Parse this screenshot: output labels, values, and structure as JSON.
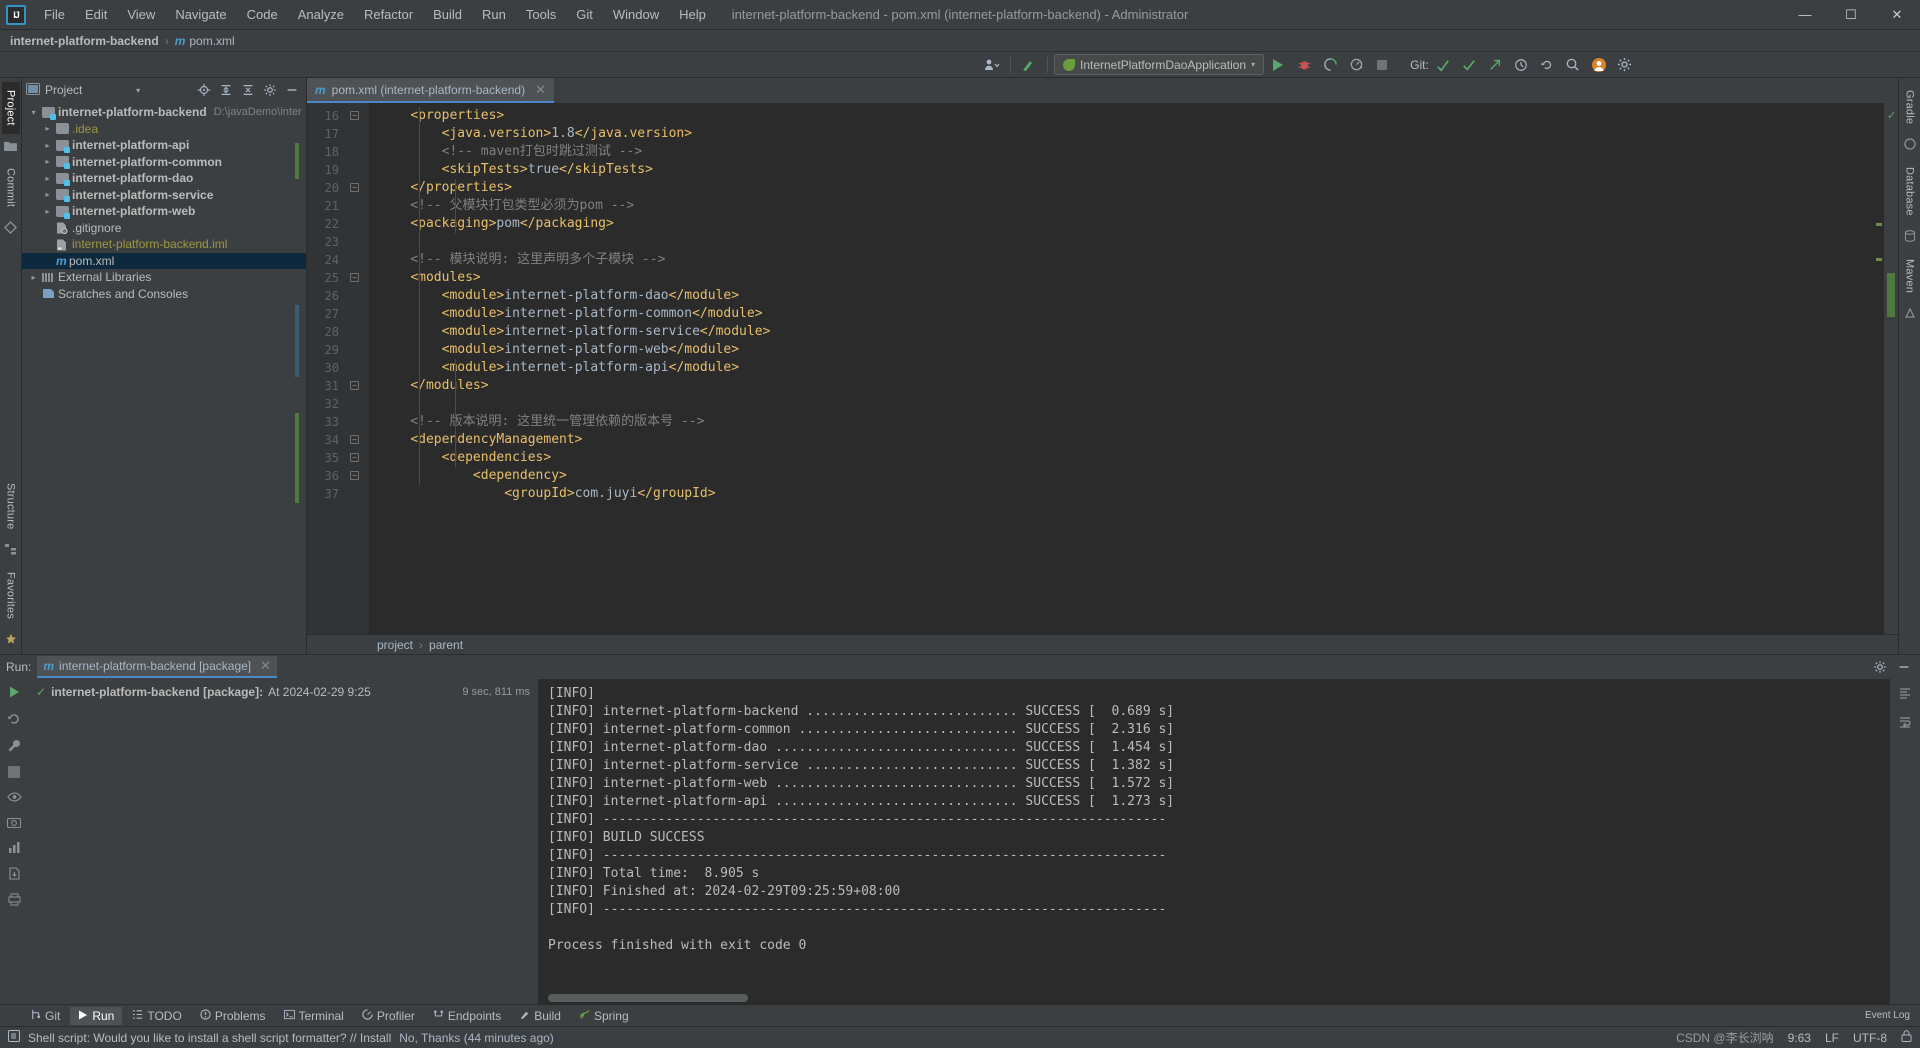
{
  "window": {
    "title": "internet-platform-backend - pom.xml (internet-platform-backend) - Administrator",
    "minimize": "—",
    "maximize": "☐",
    "close": "✕"
  },
  "menu": [
    "File",
    "Edit",
    "View",
    "Navigate",
    "Code",
    "Analyze",
    "Refactor",
    "Build",
    "Run",
    "Tools",
    "Git",
    "Window",
    "Help"
  ],
  "navbar": {
    "project": "internet-platform-backend",
    "separator": "›",
    "file": "pom.xml",
    "file_icon": "m"
  },
  "toolbar": {
    "user_icon": "user-dropdown",
    "vcs_update": "update-project",
    "run_config": "InternetPlatformDaoApplication",
    "run_caret": "▾",
    "run": "run-button",
    "debug": "debug-button",
    "coverage": "coverage-button",
    "profile": "profile-button",
    "stop": "stop-button",
    "git_label": "Git:",
    "search": "search-icon",
    "settings": "settings-icon"
  },
  "left_rail": {
    "tabs": [
      "Project",
      "Commit"
    ],
    "active": "Project"
  },
  "right_rail": {
    "tabs": [
      "Gradle",
      "Database",
      "Maven"
    ]
  },
  "bottom_left_rail": {
    "tabs": [
      "Structure",
      "Favorites"
    ]
  },
  "project_panel": {
    "title": "Project",
    "caret": "▾",
    "actions": [
      "locate-icon",
      "expand-all-icon",
      "collapse-all-icon",
      "settings-icon",
      "hide-icon"
    ],
    "tree": [
      {
        "indent": 0,
        "arrow": "v",
        "icon": "module-folder",
        "label": "internet-platform-backend",
        "bold": true,
        "path": "D:\\javaDemo\\internetPla",
        "selected": false
      },
      {
        "indent": 1,
        "arrow": ">",
        "icon": "folder",
        "label": ".idea",
        "bold": false,
        "color": "olive",
        "selected": false
      },
      {
        "indent": 1,
        "arrow": ">",
        "icon": "module-folder",
        "label": "internet-platform-api",
        "bold": true,
        "selected": false
      },
      {
        "indent": 1,
        "arrow": ">",
        "icon": "module-folder",
        "label": "internet-platform-common",
        "bold": true,
        "selected": false
      },
      {
        "indent": 1,
        "arrow": ">",
        "icon": "module-folder",
        "label": "internet-platform-dao",
        "bold": true,
        "selected": false
      },
      {
        "indent": 1,
        "arrow": ">",
        "icon": "module-folder",
        "label": "internet-platform-service",
        "bold": true,
        "selected": false
      },
      {
        "indent": 1,
        "arrow": ">",
        "icon": "module-folder",
        "label": "internet-platform-web",
        "bold": true,
        "selected": false
      },
      {
        "indent": 1,
        "arrow": "",
        "icon": "gitignore-file",
        "label": ".gitignore",
        "bold": false,
        "selected": false
      },
      {
        "indent": 1,
        "arrow": "",
        "icon": "iml-file",
        "label": "internet-platform-backend.iml",
        "bold": false,
        "color": "olive",
        "selected": false
      },
      {
        "indent": 1,
        "arrow": "",
        "icon": "maven-file",
        "label": "pom.xml",
        "bold": false,
        "selected": true
      },
      {
        "indent": 0,
        "arrow": ">",
        "icon": "library",
        "label": "External Libraries",
        "bold": false,
        "selected": false
      },
      {
        "indent": 0,
        "arrow": "",
        "icon": "scratch",
        "label": "Scratches and Consoles",
        "bold": false,
        "selected": false
      }
    ]
  },
  "editor": {
    "tab": {
      "icon": "m",
      "label": "pom.xml (internet-platform-backend)",
      "close": "✕"
    },
    "first_line": 16,
    "lines": [
      {
        "n": 16,
        "fold": "open",
        "vcs": "",
        "text": "    <properties>"
      },
      {
        "n": 17,
        "fold": "",
        "vcs": "",
        "text": "        <java.version>1.8</java.version>"
      },
      {
        "n": 18,
        "fold": "",
        "vcs": "green",
        "text": "        <!-- maven打包时跳过测试 -->"
      },
      {
        "n": 19,
        "fold": "",
        "vcs": "green",
        "text": "        <skipTests>true</skipTests>"
      },
      {
        "n": 20,
        "fold": "close",
        "vcs": "",
        "text": "    </properties>"
      },
      {
        "n": 21,
        "fold": "",
        "vcs": "",
        "text": "    <!-- 父模块打包类型必须为pom -->"
      },
      {
        "n": 22,
        "fold": "",
        "vcs": "",
        "text": "    <packaging>pom</packaging>"
      },
      {
        "n": 23,
        "fold": "",
        "vcs": "",
        "text": ""
      },
      {
        "n": 24,
        "fold": "",
        "vcs": "",
        "text": "    <!-- 模块说明: 这里声明多个子模块 -->"
      },
      {
        "n": 25,
        "fold": "open",
        "vcs": "",
        "text": "    <modules>"
      },
      {
        "n": 26,
        "fold": "",
        "vcs": "",
        "text": "        <module>internet-platform-dao</module>"
      },
      {
        "n": 27,
        "fold": "",
        "vcs": "blue",
        "text": "        <module>internet-platform-common</module>"
      },
      {
        "n": 28,
        "fold": "",
        "vcs": "blue",
        "text": "        <module>internet-platform-service</module>"
      },
      {
        "n": 29,
        "fold": "",
        "vcs": "blue",
        "text": "        <module>internet-platform-web</module>"
      },
      {
        "n": 30,
        "fold": "",
        "vcs": "blue",
        "text": "        <module>internet-platform-api</module>"
      },
      {
        "n": 31,
        "fold": "close",
        "vcs": "",
        "text": "    </modules>"
      },
      {
        "n": 32,
        "fold": "",
        "vcs": "",
        "text": ""
      },
      {
        "n": 33,
        "fold": "",
        "vcs": "green",
        "text": "    <!-- 版本说明: 这里统一管理依赖的版本号 -->"
      },
      {
        "n": 34,
        "fold": "open",
        "vcs": "green",
        "text": "    <dependencyManagement>"
      },
      {
        "n": 35,
        "fold": "open",
        "vcs": "green",
        "text": "        <dependencies>"
      },
      {
        "n": 36,
        "fold": "open",
        "vcs": "green",
        "text": "            <dependency>"
      },
      {
        "n": 37,
        "fold": "",
        "vcs": "green",
        "text": "                <groupId>com.juyi</groupId>"
      }
    ],
    "breadcrumbs": [
      "project",
      "parent"
    ],
    "breadcrumb_sep": "›",
    "inspection_ok": "✓"
  },
  "run_panel": {
    "label": "Run:",
    "tab_icon": "m",
    "tab_label": "internet-platform-backend [package]",
    "tab_close": "✕",
    "tree_row": {
      "check": "✓",
      "name": "internet-platform-backend [package]:",
      "status": "At 2024-02-29 9:25",
      "time": "9 sec, 811 ms"
    },
    "side_actions": [
      "rerun-icon",
      "rerun-failed-icon",
      "wrench-icon",
      "stop-icon",
      "eye-icon",
      "camera-icon",
      "chart-icon",
      "export-icon",
      "print-icon"
    ],
    "right_actions": [
      "scroll-end-icon",
      "soft-wrap-icon"
    ],
    "header_actions": [
      "settings-icon",
      "hide-icon"
    ],
    "console": [
      "[INFO]",
      "[INFO] internet-platform-backend ........................... SUCCESS [  0.689 s]",
      "[INFO] internet-platform-common ............................ SUCCESS [  2.316 s]",
      "[INFO] internet-platform-dao ............................... SUCCESS [  1.454 s]",
      "[INFO] internet-platform-service ........................... SUCCESS [  1.382 s]",
      "[INFO] internet-platform-web ............................... SUCCESS [  1.572 s]",
      "[INFO] internet-platform-api ............................... SUCCESS [  1.273 s]",
      "[INFO] ------------------------------------------------------------------------",
      "[INFO] BUILD SUCCESS",
      "[INFO] ------------------------------------------------------------------------",
      "[INFO] Total time:  8.905 s",
      "[INFO] Finished at: 2024-02-29T09:25:59+08:00",
      "[INFO] ------------------------------------------------------------------------",
      "",
      "Process finished with exit code 0"
    ]
  },
  "toolwindow_bar": {
    "buttons": [
      {
        "icon": "git-icon",
        "label": "Git",
        "active": false
      },
      {
        "icon": "run-icon",
        "label": "Run",
        "active": true
      },
      {
        "icon": "todo-icon",
        "label": "TODO",
        "active": false
      },
      {
        "icon": "problems-icon",
        "label": "Problems",
        "active": false
      },
      {
        "icon": "terminal-icon",
        "label": "Terminal",
        "active": false
      },
      {
        "icon": "profiler-icon",
        "label": "Profiler",
        "active": false
      },
      {
        "icon": "endpoints-icon",
        "label": "Endpoints",
        "active": false
      },
      {
        "icon": "build-icon",
        "label": "Build",
        "active": false
      },
      {
        "icon": "spring-icon",
        "label": "Spring",
        "active": false
      }
    ],
    "right_label": "Event Log"
  },
  "statusbar": {
    "message_icon": "notification-icon",
    "message": "Shell script: Would you like to install a shell script formatter? // Install",
    "message_action": "No, Thanks (44 minutes ago)",
    "caret_position": "9:63",
    "line_sep": "LF",
    "encoding": "UTF-8",
    "watermark": "CSDN @李长浏呐"
  },
  "colors": {
    "bg": "#3c3f41",
    "editor_bg": "#2b2b2b",
    "accent": "#4a88c7",
    "tag": "#e8bf6a",
    "comment": "#808080",
    "success": "#59a869",
    "selection": "#0d293e"
  }
}
